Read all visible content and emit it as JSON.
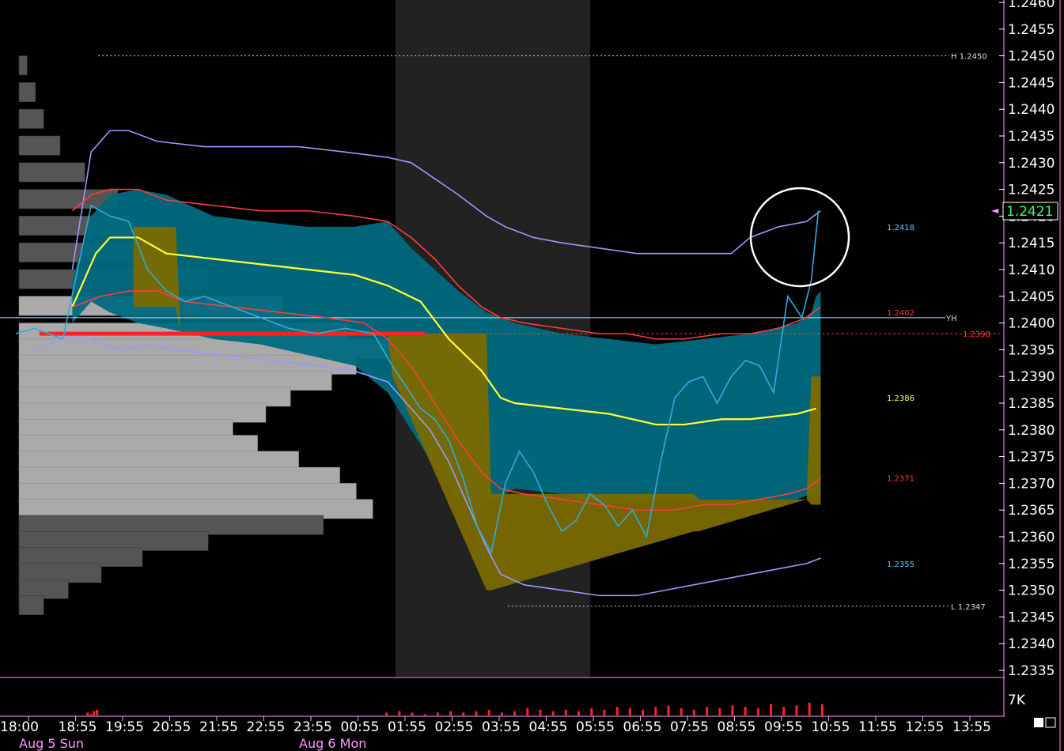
{
  "chart_data": {
    "type": "line",
    "title": "",
    "ylim": [
      1.2333,
      1.2461
    ],
    "y_ticks": [
      "1.2460",
      "1.2455",
      "1.2450",
      "1.2445",
      "1.2440",
      "1.2435",
      "1.2430",
      "1.2425",
      "1.2420",
      "1.2415",
      "1.2410",
      "1.2405",
      "1.2400",
      "1.2395",
      "1.2390",
      "1.2385",
      "1.2380",
      "1.2375",
      "1.2370",
      "1.2365",
      "1.2360",
      "1.2355",
      "1.2350",
      "1.2345",
      "1.2340",
      "1.2335"
    ],
    "x_ticks": [
      "18:00",
      "18:55",
      "19:55",
      "20:55",
      "21:55",
      "22:55",
      "23:55",
      "00:55",
      "01:55",
      "02:55",
      "03:55",
      "04:55",
      "05:55",
      "06:55",
      "07:55",
      "08:55",
      "09:55",
      "10:55",
      "11:55",
      "12:55",
      "13:55"
    ],
    "date_labels": [
      "Aug 5 Sun",
      "Aug 6 Mon"
    ],
    "last_price": "1.2421",
    "volume_axis_label": "7K",
    "session_high_label": "H 1.2450",
    "session_low_label": "L 1.2347",
    "yesterday_high_label": "YH",
    "right_labels": [
      {
        "text": "1.2418",
        "value": 1.2418,
        "color": "#55d0ff"
      },
      {
        "text": "1.2402",
        "value": 1.2402,
        "color": "#ff3b3b"
      },
      {
        "text": "1.2398",
        "value": 1.2398,
        "color": "#ff3b3b"
      },
      {
        "text": "1.2386",
        "value": 1.2386,
        "color": "#ffff66"
      },
      {
        "text": "1.2371",
        "value": 1.2371,
        "color": "#ff3b3b"
      },
      {
        "text": "1.2355",
        "value": 1.2355,
        "color": "#55d0ff"
      }
    ],
    "levels": {
      "session_high": 1.245,
      "session_low": 1.2347,
      "yesterday_high": 1.2401,
      "red_line": 1.2398
    },
    "series": [
      {
        "name": "",
        "color": "#ffff33",
        "x": [
          1.2,
          1.7,
          2.0,
          2.6,
          3.2,
          4.2,
          5.2,
          6.2,
          7.2,
          7.9,
          8.6,
          9.2,
          9.9,
          10.3,
          10.6,
          11.6,
          12.6,
          13.6,
          14.2,
          15.0,
          15.6,
          16.6,
          17.0
        ],
        "values": [
          1.2403,
          1.2413,
          1.2416,
          1.2416,
          1.2413,
          1.2412,
          1.2411,
          1.241,
          1.2409,
          1.2407,
          1.2404,
          1.2397,
          1.2391,
          1.2386,
          1.2385,
          1.2384,
          1.2383,
          1.2381,
          1.2381,
          1.2382,
          1.2382,
          1.2383,
          1.2384
        ]
      },
      {
        "name": "",
        "color": "#9999ff",
        "x": [
          1.2,
          1.6,
          2.0,
          2.4,
          3.0,
          4.0,
          5.0,
          6.0,
          7.0,
          7.9,
          8.4,
          8.9,
          9.4,
          10.0,
          10.4,
          11.0,
          11.6,
          12.4,
          13.2,
          14.0,
          14.6,
          15.2,
          15.6,
          16.2,
          16.8,
          17.1
        ],
        "values": [
          1.241,
          1.2432,
          1.2436,
          1.2436,
          1.2434,
          1.2433,
          1.2433,
          1.2433,
          1.2432,
          1.2431,
          1.243,
          1.2427,
          1.2424,
          1.242,
          1.2418,
          1.2416,
          1.2415,
          1.2414,
          1.2413,
          1.2413,
          1.2413,
          1.2413,
          1.2416,
          1.2418,
          1.2419,
          1.2421
        ]
      },
      {
        "name": "",
        "color": "#9999ff",
        "x": [
          0.4,
          1.0,
          1.6,
          2.2,
          2.8,
          3.4,
          4.4,
          5.4,
          6.4,
          7.2,
          7.9,
          8.4,
          8.8,
          9.2,
          9.6,
          10.0,
          10.3,
          10.8,
          11.6,
          12.4,
          13.2,
          13.8,
          14.4,
          15.0,
          15.6,
          16.2,
          16.8,
          17.1
        ],
        "values": [
          1.2395,
          1.2397,
          1.2397,
          1.2395,
          1.2396,
          1.2395,
          1.2394,
          1.2393,
          1.2392,
          1.2391,
          1.2389,
          1.2384,
          1.238,
          1.2374,
          1.2366,
          1.2358,
          1.2353,
          1.2351,
          1.235,
          1.2349,
          1.2349,
          1.235,
          1.2351,
          1.2352,
          1.2353,
          1.2354,
          1.2355,
          1.2356
        ]
      },
      {
        "name": "",
        "color": "#ff3b3b",
        "x": [
          1.2,
          1.6,
          2.0,
          2.6,
          3.2,
          4.2,
          5.2,
          6.2,
          7.2,
          7.9,
          8.4,
          8.9,
          9.4,
          9.9,
          10.3,
          10.8,
          11.6,
          12.4,
          13.0,
          13.6,
          14.2,
          15.0,
          15.6,
          16.2,
          16.8,
          17.1
        ],
        "values": [
          1.2421,
          1.2424,
          1.2425,
          1.2425,
          1.2423,
          1.2422,
          1.2421,
          1.2421,
          1.242,
          1.2419,
          1.2416,
          1.2412,
          1.2407,
          1.2403,
          1.2401,
          1.24,
          1.2399,
          1.2398,
          1.2398,
          1.2397,
          1.2397,
          1.2398,
          1.2398,
          1.2399,
          1.2401,
          1.2403
        ]
      },
      {
        "name": "",
        "color": "#ff3b3b",
        "x": [
          1.2,
          1.8,
          2.4,
          3.0,
          3.6,
          4.6,
          5.6,
          6.6,
          7.4,
          7.9,
          8.4,
          8.9,
          9.4,
          9.9,
          10.3,
          10.8,
          11.6,
          12.4,
          13.2,
          14.0,
          14.6,
          15.2,
          15.8,
          16.4,
          16.8,
          17.1
        ],
        "values": [
          1.2403,
          1.2405,
          1.2406,
          1.2406,
          1.2404,
          1.2403,
          1.2402,
          1.2401,
          1.24,
          1.2397,
          1.2392,
          1.2385,
          1.2378,
          1.2372,
          1.2369,
          1.2368,
          1.2367,
          1.2366,
          1.2365,
          1.2365,
          1.2366,
          1.2366,
          1.2367,
          1.2368,
          1.2369,
          1.2371
        ]
      },
      {
        "name": "",
        "color": "#33aadd",
        "x": [
          0.0,
          0.4,
          1.0,
          1.6,
          2.0,
          2.4,
          2.8,
          3.2,
          3.6,
          4.0,
          4.6,
          5.2,
          5.8,
          6.4,
          7.0,
          7.6,
          8.0,
          8.3,
          8.6,
          8.9,
          9.2,
          9.5,
          9.8,
          10.1,
          10.4,
          10.7,
          11.0,
          11.3,
          11.6,
          11.9,
          12.2,
          12.5,
          12.8,
          13.1,
          13.4,
          13.7,
          14.0,
          14.3,
          14.6,
          14.9,
          15.2,
          15.5,
          15.8,
          16.1,
          16.4,
          16.7,
          16.9,
          17.05
        ],
        "values": [
          1.2398,
          1.2399,
          1.2397,
          1.2422,
          1.242,
          1.2419,
          1.241,
          1.2406,
          1.2404,
          1.2405,
          1.2403,
          1.2401,
          1.2399,
          1.2398,
          1.2399,
          1.2398,
          1.2392,
          1.2388,
          1.2384,
          1.2382,
          1.2378,
          1.2371,
          1.2362,
          1.2357,
          1.237,
          1.2376,
          1.2372,
          1.2366,
          1.2361,
          1.2363,
          1.2368,
          1.2366,
          1.2362,
          1.2365,
          1.236,
          1.2374,
          1.2386,
          1.2389,
          1.239,
          1.2385,
          1.239,
          1.2393,
          1.2392,
          1.2387,
          1.2405,
          1.2401,
          1.2408,
          1.2421
        ]
      }
    ],
    "value_area": {
      "x": [
        1.2,
        1.6,
        2.0,
        2.6,
        3.2,
        4.2,
        5.2,
        6.2,
        7.2,
        7.9,
        8.4,
        8.9,
        9.4,
        10.0,
        10.6,
        11.6,
        12.6,
        13.6,
        14.6,
        15.6,
        16.6,
        16.9,
        17.0,
        17.1
      ],
      "upper": [
        1.2408,
        1.242,
        1.2424,
        1.2425,
        1.2424,
        1.242,
        1.2419,
        1.2418,
        1.2418,
        1.2419,
        1.2414,
        1.241,
        1.2406,
        1.2402,
        1.24,
        1.2398,
        1.2397,
        1.2396,
        1.2397,
        1.2398,
        1.24,
        1.2402,
        1.2405,
        1.2406
      ],
      "lower": [
        1.24,
        1.2404,
        1.2402,
        1.24,
        1.2399,
        1.2397,
        1.2396,
        1.2394,
        1.2392,
        1.2387,
        1.238,
        1.2373,
        1.2367,
        1.2366,
        1.2369,
        1.2368,
        1.2366,
        1.2367,
        1.2367,
        1.2367,
        1.2367,
        1.2368,
        1.2368,
        1.2368
      ]
    },
    "initial_balance_area": {
      "x": [
        2.5,
        3.4,
        3.5,
        7.9,
        8.0,
        10.0,
        10.1,
        14.4,
        14.5,
        16.8,
        16.9,
        17.1
      ],
      "upper": [
        1.2418,
        1.2418,
        1.2398,
        1.2398,
        1.2398,
        1.2398,
        1.2368,
        1.2368,
        1.2367,
        1.2367,
        1.239,
        1.239
      ],
      "lower": [
        1.2403,
        1.2403,
        1.2398,
        1.2398,
        1.239,
        1.235,
        1.235,
        1.2361,
        1.2361,
        1.2367,
        1.2366,
        1.2366
      ]
    },
    "volume_profile": {
      "y": [
        1.245,
        1.2445,
        1.244,
        1.2435,
        1.243,
        1.2425,
        1.242,
        1.2415,
        1.241,
        1.2405,
        1.24,
        1.2397,
        1.2394,
        1.2391,
        1.2388,
        1.2385,
        1.2382,
        1.2379,
        1.2376,
        1.2373,
        1.237,
        1.2367,
        1.2364,
        1.2361,
        1.2358,
        1.2355,
        1.2352,
        1.2349
      ],
      "tpo": [
        2,
        4,
        6,
        10,
        16,
        24,
        28,
        34,
        46,
        64,
        80,
        92,
        82,
        76,
        66,
        60,
        52,
        58,
        68,
        78,
        82,
        86,
        74,
        46,
        30,
        20,
        12,
        6
      ]
    },
    "volume_bars": [
      2,
      1,
      3,
      4,
      2,
      3,
      2,
      1,
      2,
      3,
      2,
      3,
      4,
      2,
      3,
      5,
      4,
      3,
      4,
      3,
      5,
      4,
      6,
      5,
      4,
      6,
      7,
      5,
      4,
      6,
      5,
      7,
      6,
      5,
      8,
      6,
      7,
      9,
      8
    ]
  }
}
